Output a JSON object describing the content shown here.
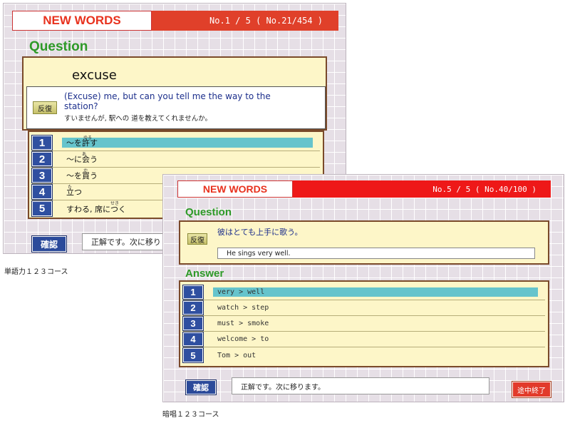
{
  "screen1": {
    "header_title": "NEW WORDS",
    "header_progress": "No.1 / 5  ( No.21/454 )",
    "question_label": "Question",
    "word": "excuse",
    "sound_button": "反復",
    "example_en": "(Excuse) me, but can you tell me the way to the station?",
    "example_jp": "すいませんが, 駅への 道を教えてくれませんか。",
    "choices": [
      {
        "num": "1",
        "text": "〜を許す",
        "ruby": "ゆる"
      },
      {
        "num": "2",
        "text": "〜に会う",
        "ruby": "あ"
      },
      {
        "num": "3",
        "text": "〜を買う",
        "ruby": "か"
      },
      {
        "num": "4",
        "text": "立つ",
        "ruby": "た"
      },
      {
        "num": "5",
        "text": "すわる, 席につく",
        "ruby": "せき"
      }
    ],
    "confirm_button": "確認",
    "message": "正解です。次に移り",
    "caption": "単語力１２３コース"
  },
  "screen2": {
    "header_title": "NEW WORDS",
    "header_progress": "No.5 / 5  ( No.40/100 )",
    "question_label": "Question",
    "sound_button": "反復",
    "question_jp": "彼はとても上手に歌う。",
    "question_en": "He sings very well.",
    "answer_label": "Answer",
    "choices": [
      {
        "num": "1",
        "text": "very  >  well"
      },
      {
        "num": "2",
        "text": "watch  >  step"
      },
      {
        "num": "3",
        "text": "must  >  smoke"
      },
      {
        "num": "4",
        "text": "welcome  >  to"
      },
      {
        "num": "5",
        "text": "Tom  >  out"
      }
    ],
    "confirm_button": "確認",
    "message": "正解です。次に移ります。",
    "quit_button": "途中終了",
    "caption": "暗唱１２３コース"
  },
  "colors": {
    "header_red_1": "#e0402a",
    "header_red_2": "#ee1818",
    "question_green": "#2e9a28",
    "number_blue": "#2f4fa0",
    "highlight_teal": "#66c4cc",
    "box_yellow": "#fdf6c8"
  }
}
